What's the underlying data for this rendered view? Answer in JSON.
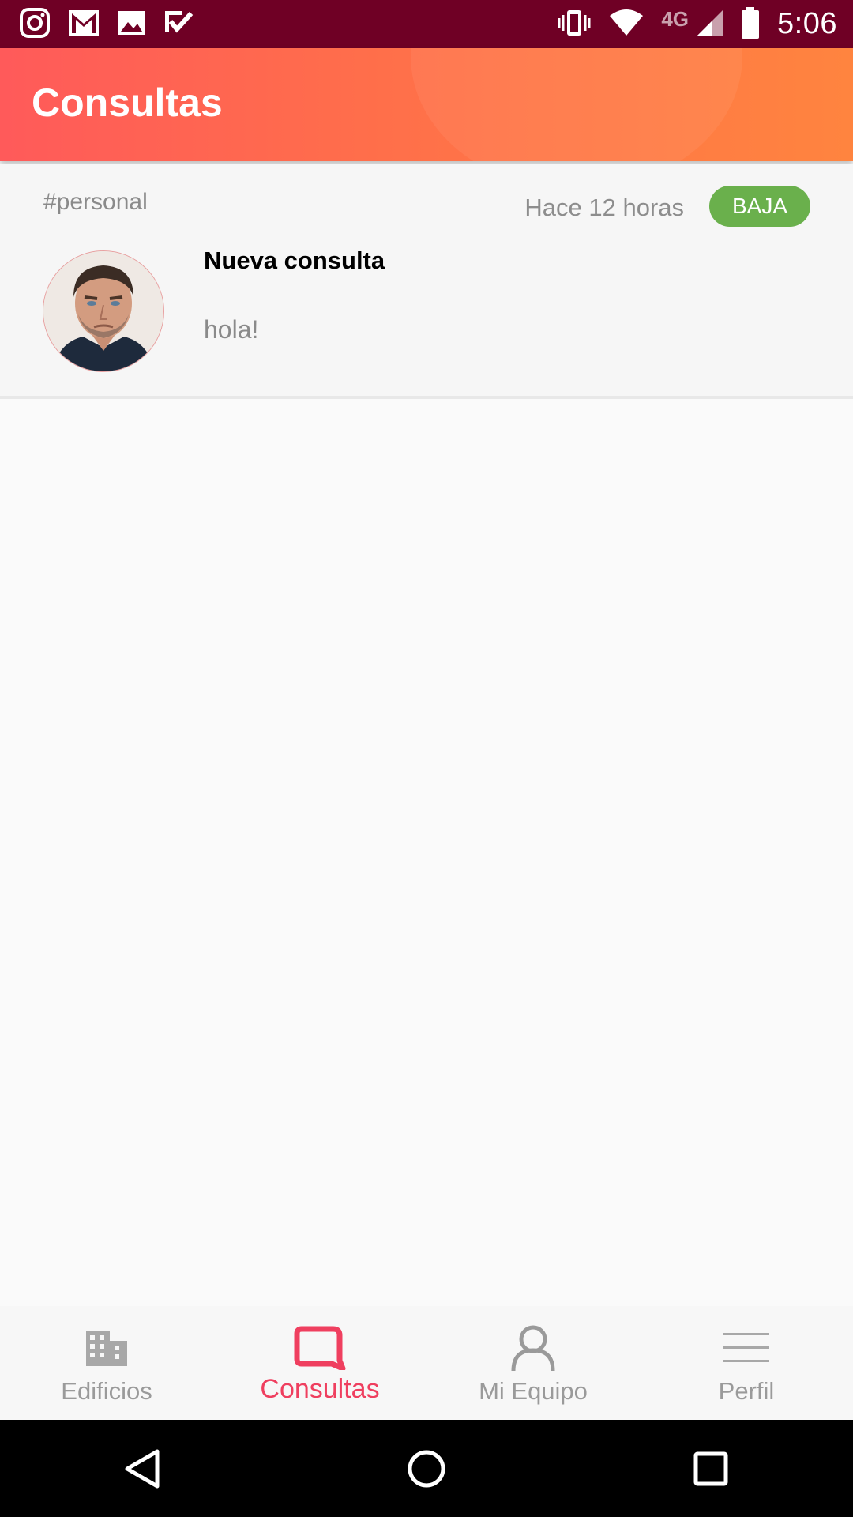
{
  "status_bar": {
    "time": "5:06",
    "network_type": "4G",
    "left_icons": [
      "instagram-icon",
      "gmail-icon",
      "gallery-icon",
      "tasks-icon"
    ],
    "right_icons": [
      "vibrate-icon",
      "wifi-icon",
      "signal-icon",
      "battery-icon"
    ]
  },
  "app_bar": {
    "title": "Consultas"
  },
  "consultas": [
    {
      "tag": "#personal",
      "time_ago": "Hace 12 horas",
      "priority": "BAJA",
      "title": "Nueva consulta",
      "message": "hola!"
    }
  ],
  "bottom_nav": {
    "items": [
      {
        "label": "Edificios",
        "icon": "building-icon",
        "active": false
      },
      {
        "label": "Consultas",
        "icon": "chat-bubble-icon",
        "active": true
      },
      {
        "label": "Mi Equipo",
        "icon": "person-icon",
        "active": false
      },
      {
        "label": "Perfil",
        "icon": "menu-icon",
        "active": false
      }
    ]
  },
  "colors": {
    "status_bar": "#6f0025",
    "app_bar_start": "#ff5a5a",
    "app_bar_end": "#ff843f",
    "badge_green": "#6ab04c",
    "active_nav": "#ef3f5f",
    "inactive_nav": "#9a9a9a"
  },
  "system_nav": {
    "buttons": [
      "back-icon",
      "home-icon",
      "recents-icon"
    ]
  }
}
